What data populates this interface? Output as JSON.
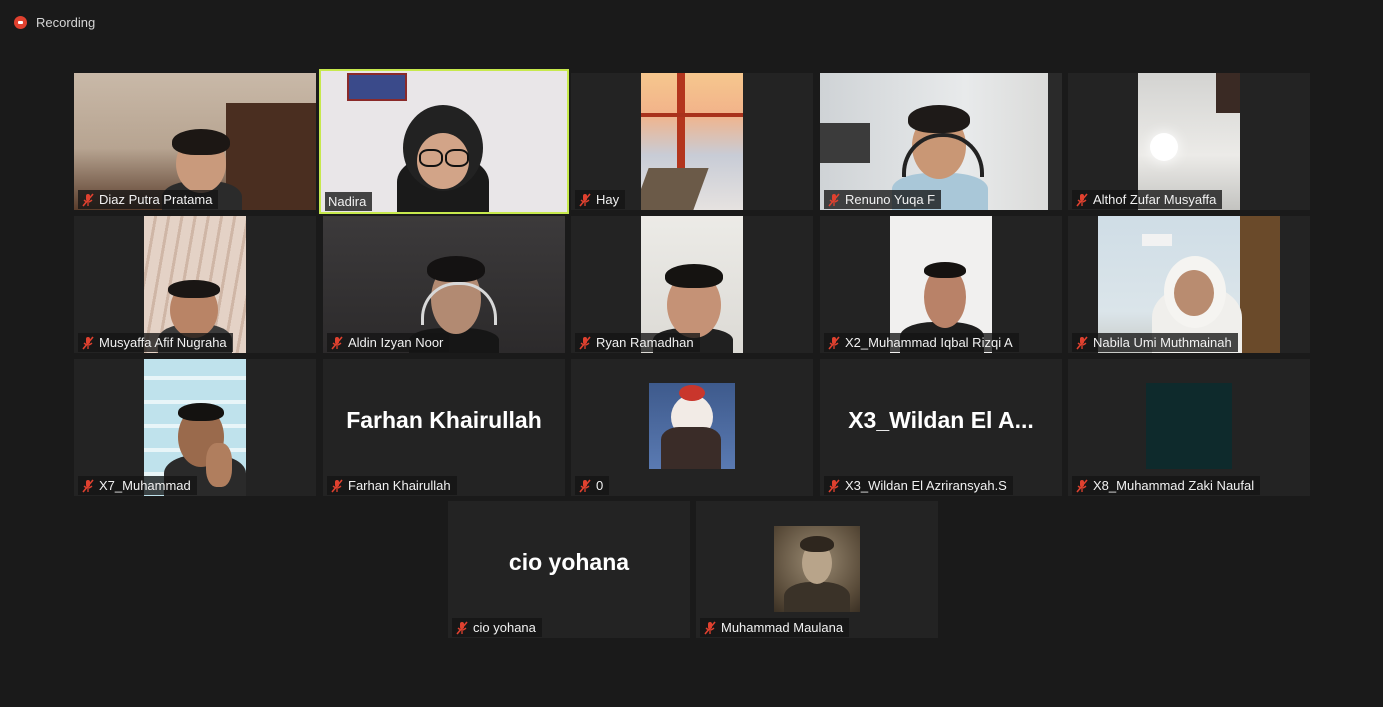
{
  "recording": {
    "label": "Recording",
    "icon": "record-icon",
    "color": "#e0412f"
  },
  "active_speaker_color": "#c7e94d",
  "mic_icon": "muted-mic-icon",
  "participants": [
    {
      "name": "Diaz Putra Pratama"
    },
    {
      "name": "Nadira"
    },
    {
      "name": "Hay"
    },
    {
      "name": "Renuno Yuqa F"
    },
    {
      "name": "Althof Zufar Musyaffa"
    },
    {
      "name": "Musyaffa Afif Nugraha"
    },
    {
      "name": "Aldin Izyan Noor"
    },
    {
      "name": "Ryan Ramadhan"
    },
    {
      "name": "X2_Muhammad Iqbal Rizqi A"
    },
    {
      "name": "Nabila Umi Muthmainah"
    },
    {
      "name": "X7_Muhammad"
    },
    {
      "name": "Farhan Khairullah",
      "display_name": "Farhan Khairullah"
    },
    {
      "name": "0"
    },
    {
      "name": "X3_Wildan El Azriransyah.S",
      "display_name": "X3_Wildan El A..."
    },
    {
      "name": "X8_Muhammad Zaki Naufal"
    },
    {
      "name": "cio yohana",
      "display_name": "cio yohana"
    },
    {
      "name": "Muhammad Maulana"
    }
  ]
}
